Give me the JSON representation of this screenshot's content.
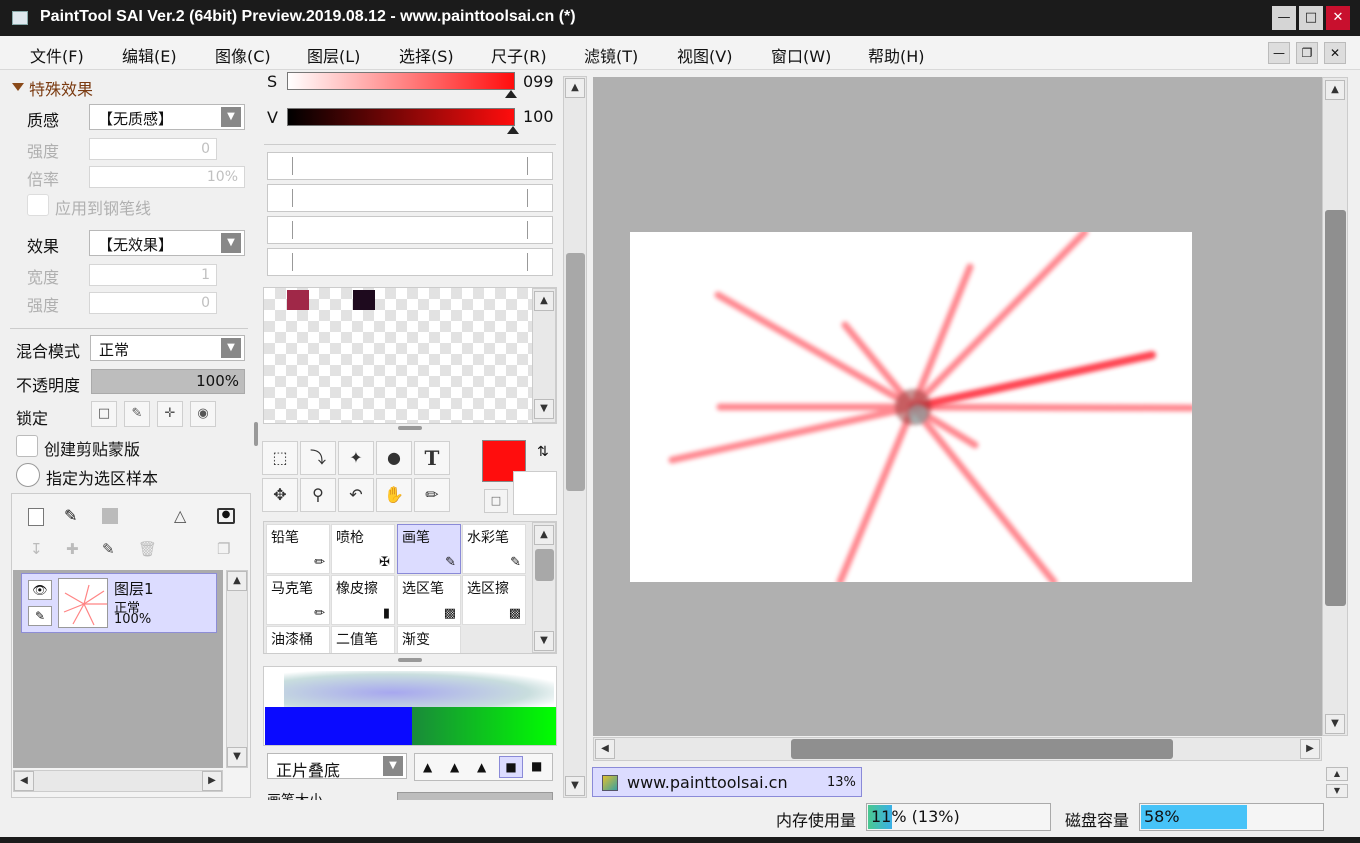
{
  "window": {
    "title": "PaintTool SAI Ver.2 (64bit) Preview.2019.08.12 - www.painttoolsai.cn (*)"
  },
  "menu": [
    "文件(F)",
    "编辑(E)",
    "图像(C)",
    "图层(L)",
    "选择(S)",
    "尺子(R)",
    "滤镜(T)",
    "视图(V)",
    "窗口(W)",
    "帮助(H)"
  ],
  "special_effects": {
    "header": "特殊效果",
    "texture_label": "质感",
    "texture_value": "【无质感】",
    "strength_label": "强度",
    "strength_value": "0",
    "scale_label": "倍率",
    "scale_value": "10%",
    "apply_pen_label": "应用到钢笔线",
    "effect_label": "效果",
    "effect_value": "【无效果】",
    "width_label": "宽度",
    "width_value": "1",
    "strength2_label": "强度",
    "strength2_value": "0"
  },
  "layer_props": {
    "blend_label": "混合模式",
    "blend_value": "正常",
    "opacity_label": "不透明度",
    "opacity_value": "100%",
    "lock_label": "锁定",
    "clip_label": "创建剪贴蒙版",
    "sample_label": "指定为选区样本"
  },
  "layer": {
    "name": "图层1",
    "mode": "正常",
    "opacity": "100%"
  },
  "color": {
    "s_label": "S",
    "s_value": "099",
    "v_label": "V",
    "v_value": "100",
    "primary": "#ff0d0d",
    "swatch1": "#a02848",
    "swatch2": "#1e0a1e"
  },
  "brushes": [
    {
      "name": "铅笔",
      "icon": "pencil-icon"
    },
    {
      "name": "喷枪",
      "icon": "airbrush-icon"
    },
    {
      "name": "画笔",
      "icon": "brush-icon"
    },
    {
      "name": "水彩笔",
      "icon": "watercolor-icon"
    },
    {
      "name": "马克笔",
      "icon": "marker-icon"
    },
    {
      "name": "橡皮擦",
      "icon": "eraser-icon"
    },
    {
      "name": "选区笔",
      "icon": "selpen-icon"
    },
    {
      "name": "选区擦",
      "icon": "selerase-icon"
    },
    {
      "name": "油漆桶",
      "icon": ""
    },
    {
      "name": "二值笔",
      "icon": ""
    },
    {
      "name": "渐变",
      "icon": ""
    }
  ],
  "brush_mode": {
    "value": "正片叠底"
  },
  "brush_size_label": "画笔大小",
  "doc_tab": {
    "name": "www.painttoolsai.cn",
    "zoom": "13%"
  },
  "status": {
    "memory_label": "内存使用量",
    "memory_value": "11% (13%)",
    "memory_fraction": 0.11,
    "disk_label": "磁盘容量",
    "disk_value": "58%",
    "disk_fraction": 0.58
  }
}
